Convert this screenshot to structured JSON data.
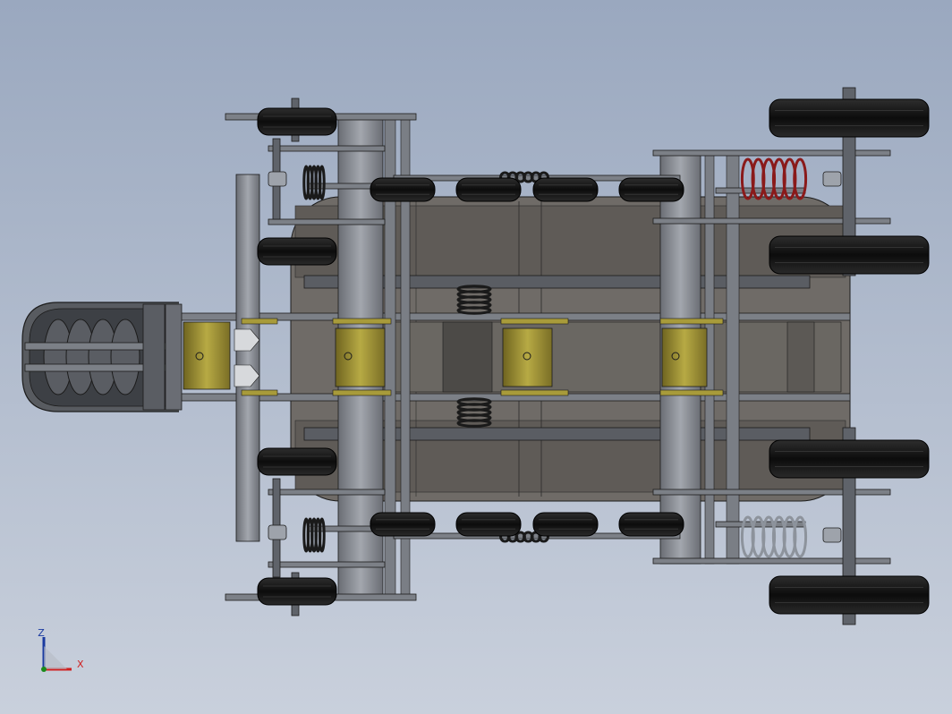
{
  "viewport": {
    "background_top": "#9aa8bf",
    "background_bottom": "#c9d0dc"
  },
  "colors": {
    "chassis": "#6e6a66",
    "chassis_dark": "#4a4744",
    "frame": "#8c8f96",
    "frame_dark": "#55585e",
    "tire": "#121212",
    "tire_hi": "#3a3a3a",
    "brass": "#a89b3a",
    "brass_dark": "#6f6420",
    "spring_red": "#8a1a1a",
    "spring_black": "#1a1a1a",
    "spring_gray": "#8d939c",
    "outline": "#1c1c1c"
  },
  "triad": {
    "x_label": "X",
    "z_label": "Z",
    "x_color": "#d02020",
    "z_color": "#1a3aa0",
    "origin_color": "#1a8a1a"
  }
}
